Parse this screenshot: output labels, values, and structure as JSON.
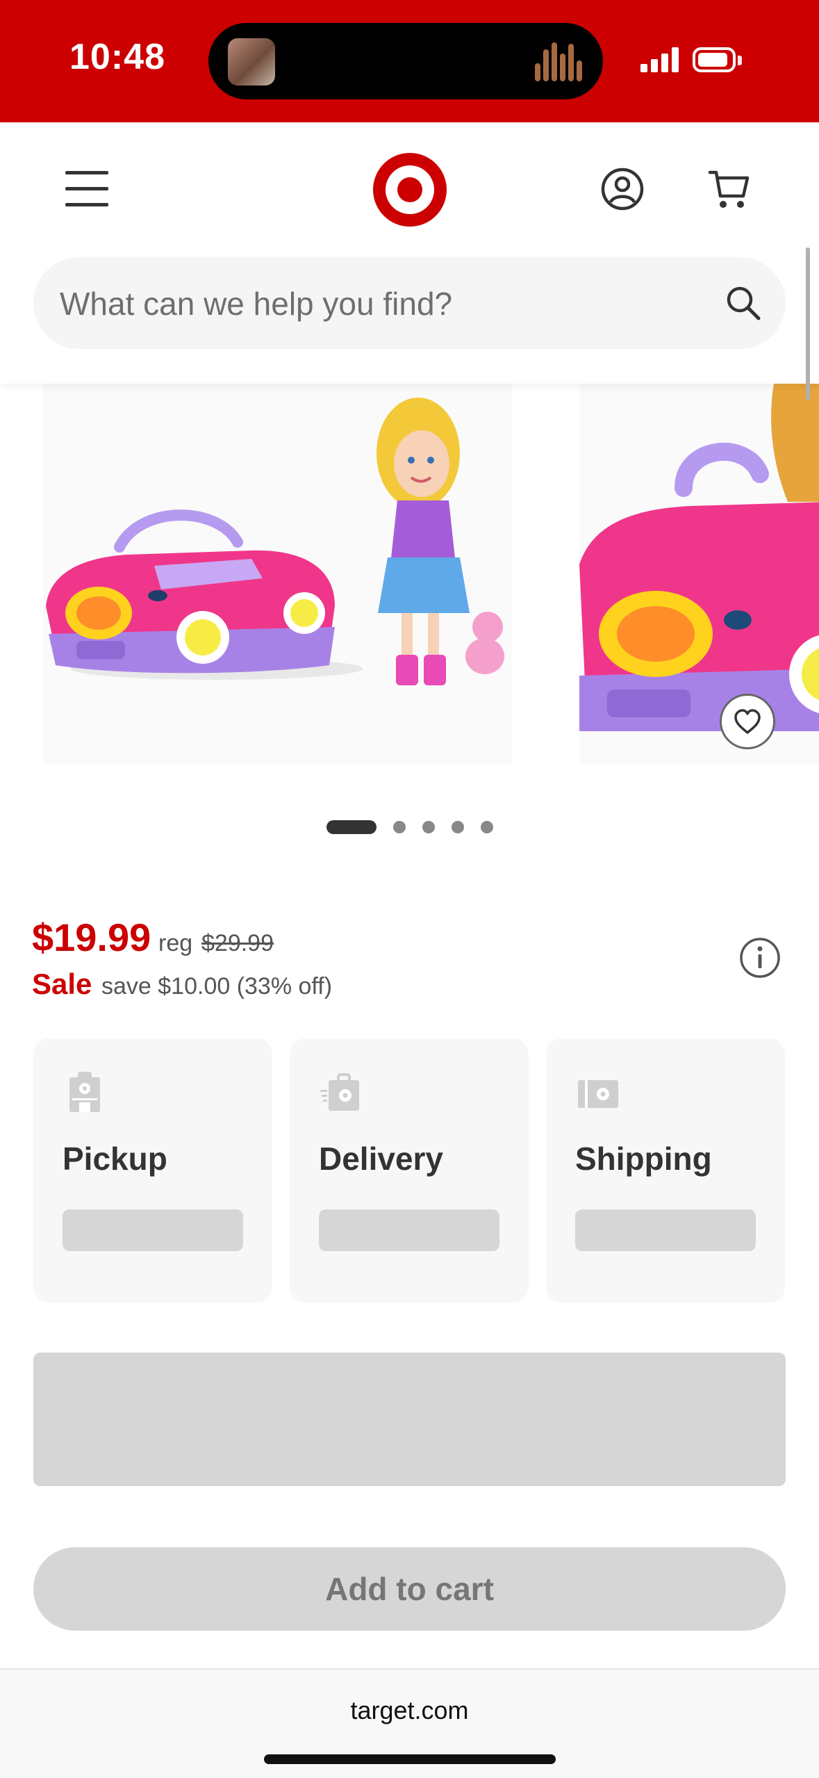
{
  "status_bar": {
    "time": "10:48"
  },
  "header": {
    "logo_name": "target-logo-icon"
  },
  "search": {
    "placeholder": "What can we help you find?"
  },
  "carousel": {
    "slide_count": 5,
    "active_index": 0
  },
  "price": {
    "current": "$19.99",
    "reg_label": "reg",
    "reg_price": "$29.99",
    "sale_label": "Sale",
    "save_text": "save $10.00 (33% off)"
  },
  "fulfillment": {
    "pickup_label": "Pickup",
    "delivery_label": "Delivery",
    "shipping_label": "Shipping"
  },
  "actions": {
    "add_to_cart_label": "Add to cart"
  },
  "browser": {
    "url": "target.com"
  },
  "colors": {
    "brand": "#cc0000",
    "disabled": "#d6d6d6"
  }
}
